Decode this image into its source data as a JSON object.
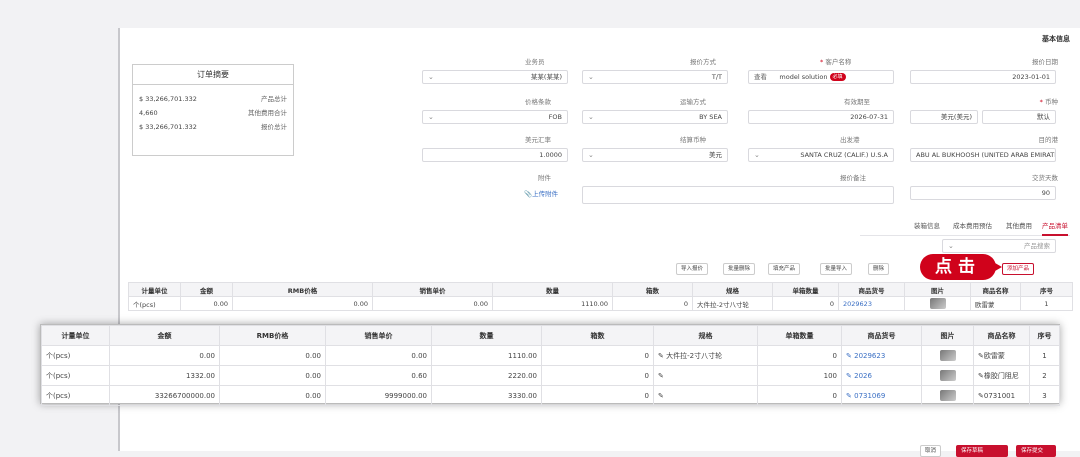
{
  "section_title": "基本信息",
  "fields": {
    "f1": {
      "label": "报价日期",
      "value": "2023-01-01"
    },
    "f2": {
      "label": "客户名称",
      "value": "model solution",
      "tag": "必填",
      "extra": "查看"
    },
    "f3": {
      "label": "报价方式",
      "value": "T/T"
    },
    "f4": {
      "label": "业务员",
      "value": "某某(某某)"
    },
    "f5": {
      "label": "币种",
      "value": "美元(美元)",
      "value2": "默认"
    },
    "f6": {
      "label": "有效期至",
      "value": "2026-07-31"
    },
    "f7": {
      "label": "运输方式",
      "value": "BY SEA"
    },
    "f8": {
      "label": "价格条款",
      "value": "FOB"
    },
    "f9": {
      "label": "目的港",
      "value": "ABU AL BUKHOOSH (UNITED ARAB EMIRATES)"
    },
    "f10": {
      "label": "出发港",
      "value": "SANTA CRUZ (CALIF.) U.S.A"
    },
    "f11": {
      "label": "结算币种",
      "value": "美元"
    },
    "f12": {
      "label": "美元汇率",
      "value": "1.0000"
    },
    "f13": {
      "label": "交货天数",
      "value": "90"
    },
    "f14": {
      "label": "报价备注",
      "value": ""
    },
    "f15": {
      "label": "附件",
      "value": "上传附件"
    }
  },
  "summary": {
    "title": "订单摘要",
    "rows": [
      {
        "k": "产品总计",
        "v": "$ 33,266,701.332"
      },
      {
        "k": "其他费用合计",
        "v": "4,660"
      },
      {
        "k": "报价总计",
        "v": "$ 33,266,701.332"
      }
    ]
  },
  "tabs": [
    "产品清单",
    "其他费用",
    "成本费用预估",
    "装箱信息"
  ],
  "search_placeholder": "产品搜索",
  "toolbar": {
    "add": "添加产品",
    "b1": "删除",
    "b2": "批量导入",
    "b3": "填充产品",
    "b4": "批量删除",
    "b5": "导入报价"
  },
  "callout": "点击",
  "table": {
    "headers": [
      "序号",
      "商品名称",
      "图片",
      "商品货号",
      "单箱数量",
      "规格",
      "箱数",
      "数量",
      "销售单价",
      "RMB价格",
      "金额",
      "计量单位"
    ],
    "rows": [
      {
        "no": "1",
        "name": "欧雷蒙",
        "code": "2029623",
        "box_qty": "0",
        "spec": "大件拉-2寸八寸轮",
        "boxes": "0",
        "qty": "1110.00",
        "price": "0.00",
        "rmb": "0.00",
        "amount": "0.00",
        "unit": "个(pcs)"
      },
      {
        "no": "2",
        "name": "橡胶门阻尼",
        "code": "2026",
        "box_qty": "100",
        "spec": "",
        "boxes": "0",
        "qty": "2220.00",
        "price": "0.60",
        "rmb": "0.00",
        "amount": "1332.00",
        "unit": "个(pcs)"
      },
      {
        "no": "3",
        "name": "0731001",
        "code": "0731069",
        "box_qty": "0",
        "spec": "",
        "boxes": "0",
        "qty": "3330.00",
        "price": "9999000.00",
        "rmb": "0.00",
        "amount": "33266700000.00",
        "unit": "个(pcs)"
      }
    ]
  },
  "footer": {
    "cancel": "取消",
    "save_draft": "保存草稿",
    "submit": "保存提交"
  }
}
